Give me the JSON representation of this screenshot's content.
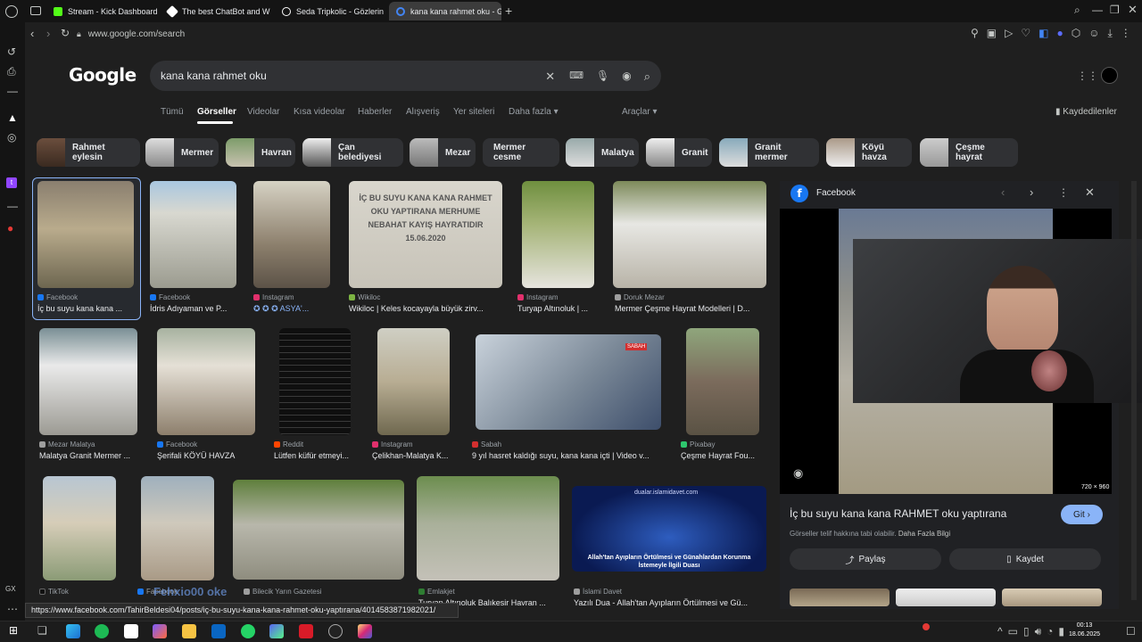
{
  "tabs": [
    {
      "label": "Stream - Kick Dashboard",
      "color": "#53fc18"
    },
    {
      "label": "The best ChatBot and W",
      "color": "#ffffff"
    },
    {
      "label": "Seda Tripkolic - Gözlerin",
      "color": "#ffffff"
    },
    {
      "label": "kana kana rahmet oku - G",
      "color": "#4285f4"
    }
  ],
  "address": {
    "url": "www.google.com/search"
  },
  "search": {
    "query": "kana kana rahmet oku",
    "logo": "Google"
  },
  "nav_tabs": [
    "Tümü",
    "Görseller",
    "Videolar",
    "Kısa videolar",
    "Haberler",
    "Alışveriş",
    "Yer siteleri",
    "Daha fazla ▾"
  ],
  "tools": "Araçlar ▾",
  "saved": "Kaydedilenler",
  "chips": [
    "Rahmet eylesin",
    "Mermer",
    "Havran",
    "Çan belediyesi",
    "Mezar",
    "Mermer cesme",
    "Malatya",
    "Granit",
    "Granit mermer",
    "Köyü havza",
    "Çeşme hayrat"
  ],
  "results": [
    {
      "source": "Facebook",
      "title": "İç bu suyu kana kana ...",
      "color": "#1877f2"
    },
    {
      "source": "Facebook",
      "title": "İdris Adıyaman ve P...",
      "color": "#1877f2"
    },
    {
      "source": "Instagram",
      "title": "✪ ✪ ✪ ASYA'...",
      "color": "#e1306c"
    },
    {
      "source": "Wikiloc",
      "title": "Wikiloc | Keles kocayayla büyük zirv...",
      "color": "#7cb342"
    },
    {
      "source": "Instagram",
      "title": "Turyap Altınoluk | ...",
      "color": "#e1306c"
    },
    {
      "source": "Doruk Mezar",
      "title": "Mermer Çeşme Hayrat Modelleri | D...",
      "color": "#9e9e9e"
    },
    {
      "source": "Mezar Malatya",
      "title": "Malatya Granit Mermer ...",
      "color": "#9e9e9e"
    },
    {
      "source": "Facebook",
      "title": "Şerifali KÖYÜ HAVZA",
      "color": "#1877f2"
    },
    {
      "source": "Reddit",
      "title": "Lütfen küfür etmeyi...",
      "color": "#ff4500"
    },
    {
      "source": "Instagram",
      "title": "Çelikhan-Malatya K...",
      "color": "#e1306c"
    },
    {
      "source": "Sabah",
      "title": "9 yıl hasret kaldığı suyu, kana kana içti | Video v...",
      "color": "#d32f2f"
    },
    {
      "source": "Pixabay",
      "title": "Çeşme Hayrat Fou...",
      "color": "#2ec66d"
    },
    {
      "source": "TikTok",
      "title": "",
      "color": "#111111"
    },
    {
      "source": "Facebook",
      "title": "",
      "color": "#1877f2"
    },
    {
      "source": "Bilecik Yarın Gazetesi",
      "title": "",
      "color": "#9e9e9e"
    },
    {
      "source": "Emlakjet",
      "title": "Turyap Altınoluk Balıkesir Havran ...",
      "color": "#2e7d32"
    },
    {
      "source": "İslami Davet",
      "title": "Yazılı Dua - Allah'tan Ayıpların Örtülmesi ve Gü...",
      "color": "#9e9e9e"
    }
  ],
  "thumb_text": {
    "sign": "İÇ BU SUYU KANA KANA RAHMET OKU YAPTIRANA MERHUME NEBAHAT KAYIŞ HAYRATIDIR 15.06.2020",
    "dua": "Allah'tan Ayıpların Örtülmesi ve Günahlardan Korunma İstemeyle İlgili Duası",
    "dua_site": "dualar.islamidavet.com",
    "sabah": "SABAH"
  },
  "overlay": {
    "watermark": "Fehxio00 oke"
  },
  "panel": {
    "source": "Facebook",
    "title": "İç bu suyu kana kana RAHMET oku yaptırana",
    "visit": "Git ›",
    "note": "Görseller telif hakkına tabi olabilir.",
    "more": "Daha Fazla Bilgi",
    "share": "Paylaş",
    "save": "Kaydet",
    "size": "720 × 960"
  },
  "status_url": "https://www.facebook.com/TahirBeldesi04/posts/iç-bu-suyu-kana-kana-rahmet-oku-yaptırana/4014583871982021/",
  "clock": {
    "time": "00:13",
    "date": "18.06.2025"
  }
}
